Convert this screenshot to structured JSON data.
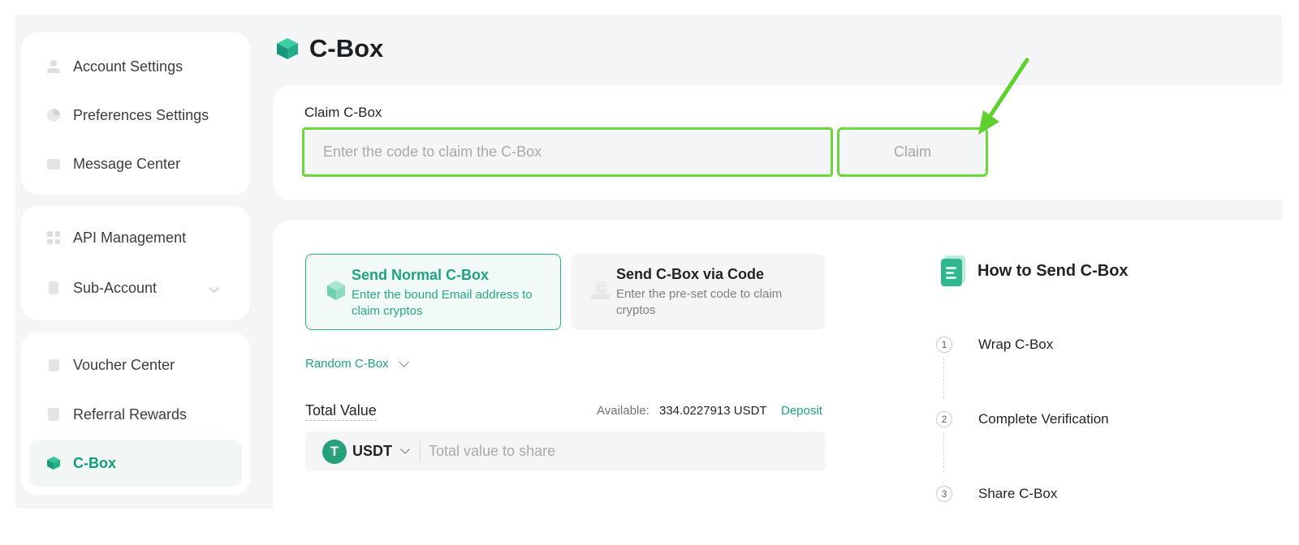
{
  "sidebar": {
    "groups": [
      {
        "items": [
          {
            "label": "Account Settings",
            "icon": "user-icon"
          },
          {
            "label": "Preferences Settings",
            "icon": "preferences-icon"
          },
          {
            "label": "Message Center",
            "icon": "message-icon"
          }
        ]
      },
      {
        "items": [
          {
            "label": "API Management",
            "icon": "api-icon"
          },
          {
            "label": "Sub-Account",
            "icon": "sub-account-icon"
          }
        ]
      },
      {
        "items": [
          {
            "label": "Voucher Center",
            "icon": "voucher-icon"
          },
          {
            "label": "Referral Rewards",
            "icon": "referral-icon"
          },
          {
            "label": "C-Box",
            "icon": "cbox-icon",
            "active": true
          }
        ]
      }
    ]
  },
  "page": {
    "title": "C-Box"
  },
  "claim": {
    "label": "Claim C-Box",
    "placeholder": "Enter the code to claim the C-Box",
    "button": "Claim"
  },
  "send": {
    "options": [
      {
        "title": "Send Normal C-Box",
        "desc": "Enter the bound Email address to claim cryptos",
        "selected": true
      },
      {
        "title": "Send C-Box via Code",
        "desc": "Enter the pre-set code to claim cryptos",
        "selected": false
      }
    ],
    "mode": "Random C-Box",
    "total_value_label": "Total Value",
    "available_label": "Available:",
    "available_value": "334.0227913 USDT",
    "deposit": "Deposit",
    "coin": {
      "symbol": "T",
      "name": "USDT"
    },
    "value_placeholder": "Total value to share"
  },
  "howto": {
    "title": "How to Send C-Box",
    "steps": [
      {
        "num": "1",
        "label": "Wrap C-Box"
      },
      {
        "num": "2",
        "label": "Complete Verification"
      },
      {
        "num": "3",
        "label": "Share C-Box"
      }
    ]
  },
  "colors": {
    "accent": "#1ca380",
    "highlight": "#6ad83c",
    "pointer_arrow": "#5fd12f"
  }
}
